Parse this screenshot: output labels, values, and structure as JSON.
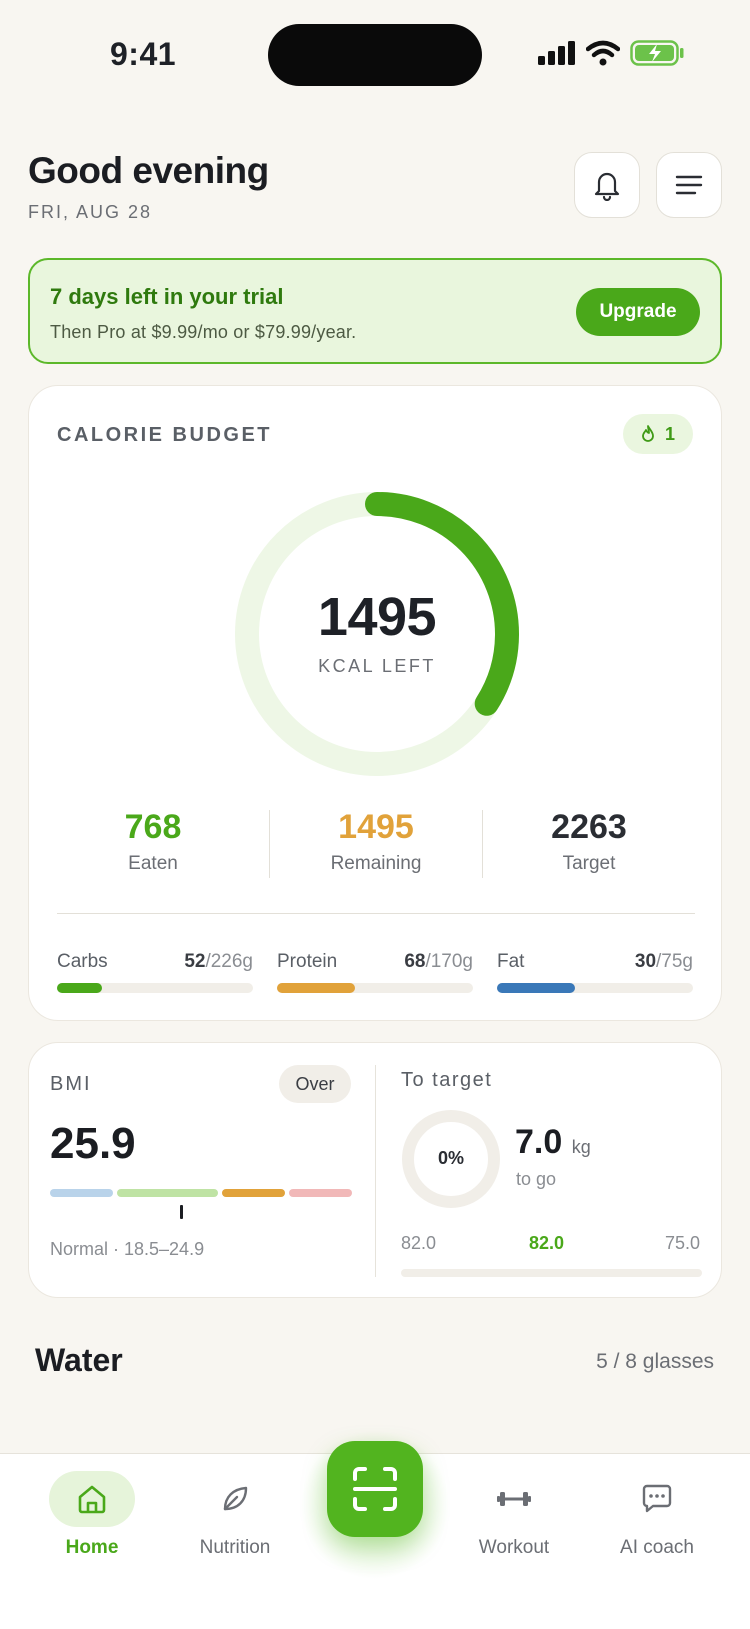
{
  "status": {
    "time": "9:41"
  },
  "header": {
    "greeting": "Good evening",
    "date": "FRI, AUG 28"
  },
  "trial": {
    "title": "7 days left in your trial",
    "subtitle": "Then Pro at $9.99/mo or $79.99/year.",
    "upgrade_label": "Upgrade"
  },
  "calorie": {
    "label": "CALORIE BUDGET",
    "streak": "1",
    "kcal_left": "1495",
    "kcal_left_label": "KCAL LEFT",
    "ring_progress": 0.34,
    "eaten": {
      "value": "768",
      "label": "Eaten"
    },
    "remaining": {
      "value": "1495",
      "label": "Remaining"
    },
    "target": {
      "value": "2263",
      "label": "Target"
    },
    "macros": [
      {
        "name": "Carbs",
        "eaten": "52",
        "goal": "/226g",
        "fraction": 0.23,
        "color": "#4aa81a"
      },
      {
        "name": "Protein",
        "eaten": "68",
        "goal": "/170g",
        "fraction": 0.4,
        "color": "#e1a23a"
      },
      {
        "name": "Fat",
        "eaten": "30",
        "goal": "/75g",
        "fraction": 0.4,
        "color": "#3a78b8"
      }
    ]
  },
  "bmi": {
    "label": "BMI",
    "status": "Over",
    "value": "25.9",
    "note": "Normal · 18.5–24.9",
    "scale_colors": [
      "#b9d3ea",
      "#bfe3a4",
      "#e1a23a",
      "#f1b8b8"
    ]
  },
  "to_target": {
    "label": "To target",
    "percent": "0%",
    "kg_value": "7.0",
    "kg_unit": "kg",
    "to_go": "to go",
    "start": "82.0",
    "current": "82.0",
    "goal": "75.0"
  },
  "water": {
    "title": "Water",
    "count": "5 / 8 glasses"
  },
  "tabs": {
    "home": "Home",
    "nutrition": "Nutrition",
    "workout": "Workout",
    "coach": "AI coach"
  },
  "colors": {
    "accent": "#4aa81a",
    "background": "#f8f6f1"
  }
}
